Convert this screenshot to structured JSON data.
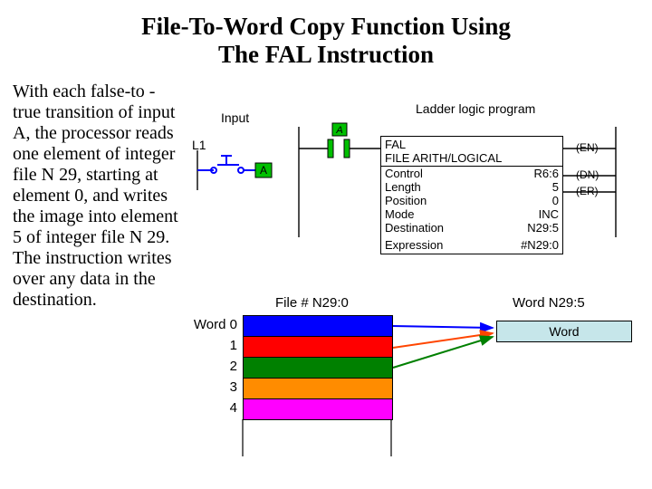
{
  "title_line1": "File-To-Word Copy Function Using",
  "title_line2": "The FAL Instruction",
  "body_text": "With each false-to -true transition of input A, the processor reads one element of integer file N 29, starting at element 0, and writes the image into element 5 of integer file N 29. The instruction writes over any data in the destination.",
  "ladder": {
    "l1": "L1",
    "input": "Input",
    "program": "Ladder logic program",
    "a1": "A",
    "a2": "A"
  },
  "fal": {
    "name": "FAL",
    "desc": "FILE ARITH/LOGICAL",
    "rows": [
      {
        "k": "Control",
        "v": "R6:6"
      },
      {
        "k": "Length",
        "v": "5"
      },
      {
        "k": "Position",
        "v": "0"
      },
      {
        "k": "Mode",
        "v": "INC"
      },
      {
        "k": "Destination",
        "v": "N29:5"
      }
    ],
    "expr_k": "Expression",
    "expr_v": "#N29:0"
  },
  "outputs": {
    "en": "(EN)",
    "dn": "(DN)",
    "er": "(ER)"
  },
  "file": {
    "title": "File # N29:0",
    "dest_title": "Word N29:5",
    "word_prefix": "Word",
    "rows": [
      "0",
      "1",
      "2",
      "3",
      "4"
    ],
    "colors": [
      "c-blue",
      "c-red",
      "c-green",
      "c-orange",
      "c-magenta"
    ],
    "dest_word": "Word"
  }
}
